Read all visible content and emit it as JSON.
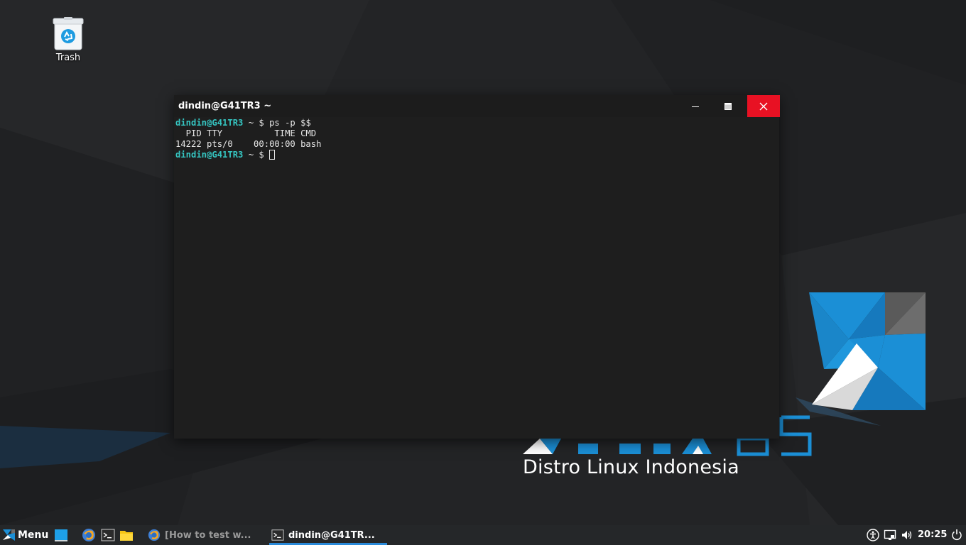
{
  "desktop": {
    "icons": [
      {
        "label": "Trash",
        "icon": "trash-icon"
      }
    ],
    "wallpaper": {
      "brand_subtitle": "Distro Linux Indonesia",
      "colors": {
        "background": "#222325",
        "accent_blue": "#1b8fd6",
        "accent_white": "#f2f2f2"
      }
    }
  },
  "terminal": {
    "title": "dindin@G41TR3 ~",
    "lines": [
      {
        "prompt_user": "dindin@G41TR3",
        "prompt_rest": " ~ $ ",
        "command": "ps -p $$"
      },
      {
        "text": "  PID TTY          TIME CMD"
      },
      {
        "text": "14222 pts/0    00:00:00 bash"
      },
      {
        "prompt_user": "dindin@G41TR3",
        "prompt_rest": " ~ $ ",
        "command": ""
      }
    ],
    "controls": {
      "minimize": "minimize-icon",
      "maximize": "maximize-icon",
      "close": "close-icon"
    },
    "colors": {
      "prompt": "#35c4c0",
      "text": "#e8e8e8",
      "close_bg": "#e81123"
    }
  },
  "taskbar": {
    "menu_label": "Menu",
    "launchers": [
      "show-desktop-icon",
      "browser-icon",
      "terminal-icon",
      "file-manager-icon"
    ],
    "tasks": [
      {
        "label": "[How to test w...",
        "icon": "browser-icon",
        "active": false
      },
      {
        "label": "dindin@G41TR...",
        "icon": "terminal-icon",
        "active": true
      }
    ],
    "tray": [
      "accessibility-icon",
      "network-icon",
      "volume-icon"
    ],
    "clock": "20:25",
    "power": "power-icon",
    "accent": "#2a8ad9"
  }
}
